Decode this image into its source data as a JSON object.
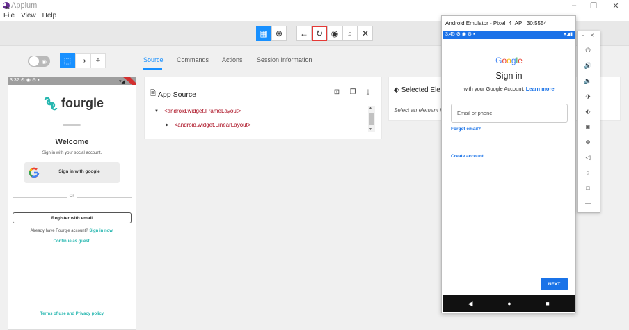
{
  "window": {
    "title": "Appium",
    "minimize": "–",
    "maximize": "❐",
    "close": "✕"
  },
  "menu": [
    "File",
    "View",
    "Help"
  ],
  "toolbar": {
    "buttons": [
      {
        "name": "grid-icon",
        "glyph": "▦"
      },
      {
        "name": "globe-icon",
        "glyph": "⊕"
      },
      {
        "name": "back-arrow-icon",
        "glyph": "←"
      },
      {
        "name": "refresh-icon",
        "glyph": "↻"
      },
      {
        "name": "eye-icon",
        "glyph": "◉"
      },
      {
        "name": "search-icon",
        "glyph": "⌕"
      },
      {
        "name": "close-session-icon",
        "glyph": "✕"
      }
    ],
    "highlighted": "refresh-icon"
  },
  "tabs": [
    "Source",
    "Commands",
    "Actions",
    "Session Information"
  ],
  "active_tab": "Source",
  "device": {
    "status_time": "3:32",
    "brand": "fourgle",
    "welcome": "Welcome",
    "subtitle": "Sign in with your social account.",
    "google_button": "Sign in with google",
    "or": "Or",
    "register_button": "Register with email",
    "already_text": "Already have Fourgle account?",
    "sign_in_link": "Sign in now.",
    "guest_link": "Continue as guest.",
    "terms": "Terms of use and Privacy policy"
  },
  "app_source": {
    "title": "App Source",
    "tree": [
      "<android.widget.FrameLayout>",
      "<android.widget.LinearLayout>"
    ]
  },
  "selected_element": {
    "title": "Selected Ele",
    "hint": "Select an element i"
  },
  "emulator": {
    "title": "Android Emulator - Pixel_4_API_30:5554",
    "status_time": "3:45",
    "google": "Google",
    "heading": "Sign in",
    "sub_text": "with your Google Account.",
    "learn_more": "Learn more",
    "email_placeholder": "Email or phone",
    "forgot_email": "Forgot email?",
    "create_account": "Create account",
    "next_button": "NEXT"
  },
  "colors": {
    "accent": "#1890ff",
    "teal": "#27b7b0",
    "google_blue": "#1a73e8",
    "xml_tag": "#a8071a",
    "highlight_border": "#e53935"
  }
}
